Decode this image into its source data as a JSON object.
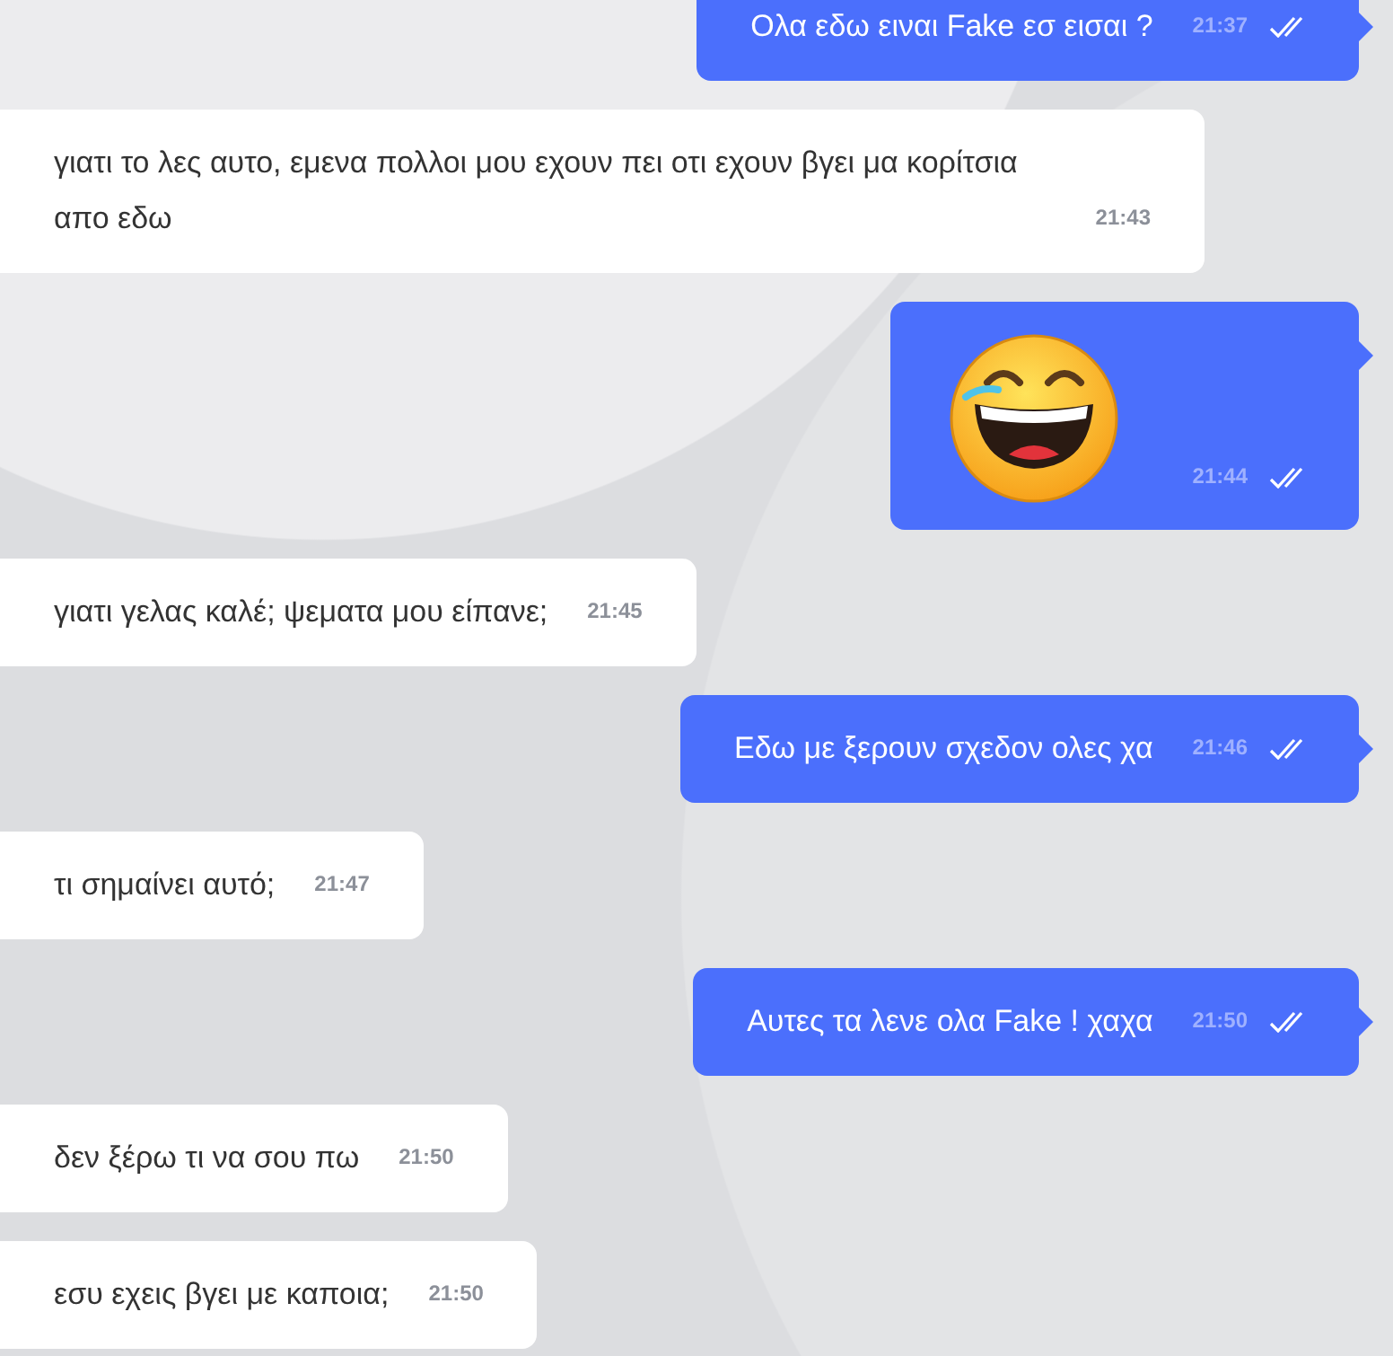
{
  "messages": [
    {
      "outgoing": true,
      "kind": "text",
      "text": "Ολα εδω ειναι Fake εσ εισαι ?",
      "time": "21:37",
      "read": true
    },
    {
      "outgoing": false,
      "kind": "text",
      "text": "γιατι το λες αυτο, εμενα πολλοι μου εχουν πει οτι εχουν βγει μα κορίτσια απο εδω",
      "time": "21:43"
    },
    {
      "outgoing": true,
      "kind": "emoji",
      "time": "21:44",
      "read": true
    },
    {
      "outgoing": false,
      "kind": "text",
      "text": "γιατι γελας καλέ; ψεματα μου είπανε;",
      "time": "21:45"
    },
    {
      "outgoing": true,
      "kind": "text",
      "text": "Εδω με ξερουν σχεδον ολες χα",
      "time": "21:46",
      "read": true
    },
    {
      "outgoing": false,
      "kind": "text",
      "text": "τι σημαίνει αυτό;",
      "time": "21:47"
    },
    {
      "outgoing": true,
      "kind": "text",
      "text": "Αυτες τα λενε ολα Fake ! χαχα",
      "time": "21:50",
      "read": true
    },
    {
      "outgoing": false,
      "kind": "text",
      "text": "δεν ξέρω τι να σου πω",
      "time": "21:50"
    },
    {
      "outgoing": false,
      "kind": "text",
      "text": "εσυ εχεις βγει με καποια;",
      "time": "21:50"
    }
  ]
}
